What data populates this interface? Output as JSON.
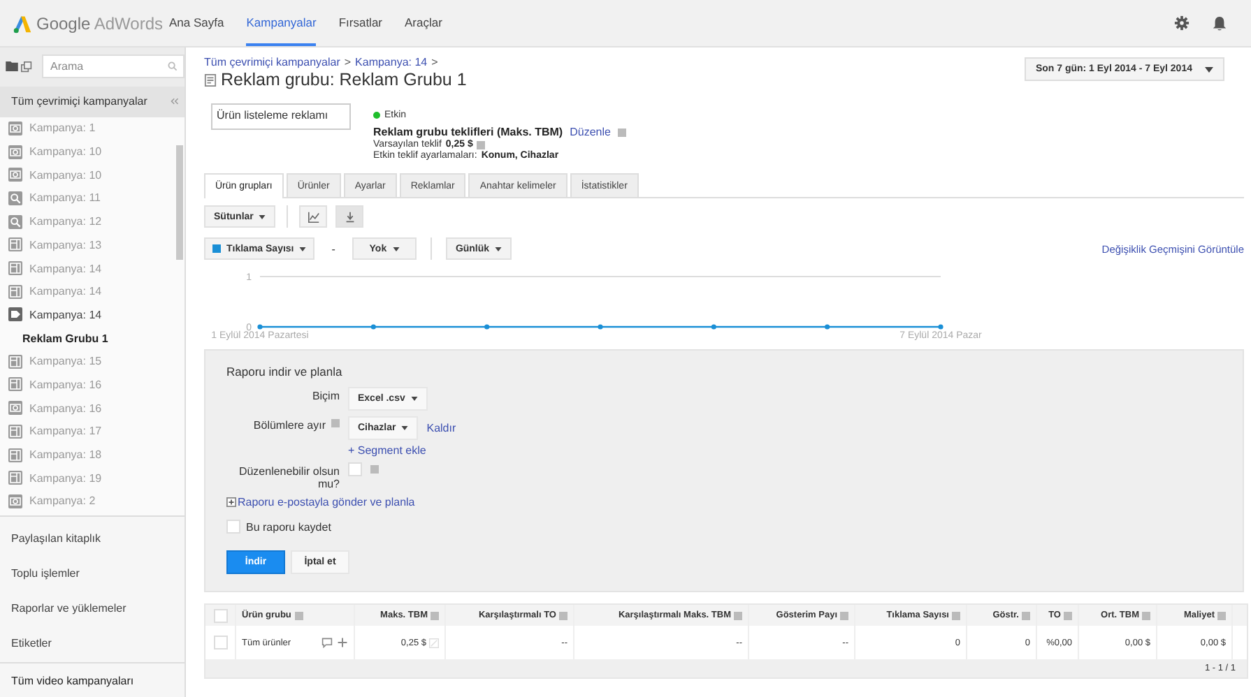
{
  "header": {
    "logo_brand": "Google",
    "logo_product": "AdWords",
    "nav": [
      {
        "label": "Ana Sayfa",
        "selected": false
      },
      {
        "label": "Kampanyalar",
        "selected": true
      },
      {
        "label": "Fırsatlar",
        "selected": false
      },
      {
        "label": "Araçlar",
        "selected": false
      }
    ]
  },
  "sidebar": {
    "search": {
      "placeholder": "Arama"
    },
    "heading": "Tüm çevrimiçi kampanyalar",
    "campaigns": [
      {
        "label": "Kampanya: 1",
        "kind": "video"
      },
      {
        "label": "Kampanya: 10",
        "kind": "video"
      },
      {
        "label": "Kampanya: 10",
        "kind": "video"
      },
      {
        "label": "Kampanya: 11",
        "kind": "search"
      },
      {
        "label": "Kampanya: 12",
        "kind": "search"
      },
      {
        "label": "Kampanya: 13",
        "kind": "display"
      },
      {
        "label": "Kampanya: 14",
        "kind": "display"
      },
      {
        "label": "Kampanya: 14",
        "kind": "display"
      },
      {
        "label": "Kampanya: 14",
        "kind": "shopping",
        "children": [
          {
            "label": "Reklam Grubu 1",
            "selected": true
          }
        ]
      },
      {
        "label": "Kampanya: 15",
        "kind": "display"
      },
      {
        "label": "Kampanya: 16",
        "kind": "display"
      },
      {
        "label": "Kampanya: 16",
        "kind": "video"
      },
      {
        "label": "Kampanya: 17",
        "kind": "display"
      },
      {
        "label": "Kampanya: 18",
        "kind": "display"
      },
      {
        "label": "Kampanya: 19",
        "kind": "display"
      },
      {
        "label": "Kampanya: 2",
        "kind": "video"
      }
    ],
    "links": [
      "Paylaşılan kitaplık",
      "Toplu işlemler",
      "Raporlar ve yüklemeler",
      "Etiketler"
    ],
    "footer_link": "Tüm video kampanyaları"
  },
  "breadcrumb": [
    {
      "label": "Tüm çevrimiçi kampanyalar",
      "separator": ">"
    },
    {
      "label": "Kampanya: 14",
      "separator": ">"
    }
  ],
  "title": "Reklam grubu: Reklam Grubu 1",
  "date_range": "Son 7 gün: 1 Eyl 2014 - 7 Eyl 2014",
  "ad_type": "Ürün listeleme reklamı",
  "status": {
    "label": "Etkin",
    "enabled": true
  },
  "bids": {
    "heading": "Reklam grubu teklifleri (Maks. TBM)",
    "edit_link": "Düzenle",
    "default_label": "Varsayılan teklif",
    "default_value": "0,25 $",
    "adjust_label": "Etkin teklif ayarlamaları:",
    "adjust_value": "Konum, Cihazlar"
  },
  "tabs": [
    {
      "label": "Ürün grupları",
      "selected": true
    },
    {
      "label": "Ürünler",
      "selected": false
    },
    {
      "label": "Ayarlar",
      "selected": false
    },
    {
      "label": "Reklamlar",
      "selected": false
    },
    {
      "label": "Anahtar kelimeler",
      "selected": false
    },
    {
      "label": "İstatistikler",
      "selected": false
    }
  ],
  "toolbar": {
    "columns_button": "Sütunlar",
    "dash": "-",
    "compare": "Yok",
    "period": "Günlük",
    "history_link": "Değişiklik Geçmişini Görüntüle"
  },
  "chart_data": {
    "type": "line",
    "categories": [
      "1 Eylül 2014 Pazartesi",
      null,
      null,
      null,
      null,
      null,
      "7 Eylül 2014 Pazar"
    ],
    "ylim": [
      0,
      1
    ],
    "yticks": [
      0,
      1
    ],
    "series": [
      {
        "name": "Tıklama Sayısı",
        "color": "#1a8fd6",
        "marker": "circle",
        "values": [
          0,
          0,
          0,
          0,
          0,
          0,
          0
        ]
      }
    ]
  },
  "report": {
    "title": "Raporu indir ve planla",
    "format_label": "Biçim",
    "format_value": "Excel .csv",
    "segment_label": "Bölümlere ayır",
    "segment_value": "Cihazlar",
    "remove_link": "Kaldır",
    "add_link": "+ Segment ekle",
    "editable": {
      "label": "Düzenlenebilir olsun mu?",
      "checked": false
    },
    "email_link": "Raporu e-postayla gönder ve planla",
    "save": {
      "label": "Bu raporu kaydet",
      "checked": false
    },
    "download_button": "İndir",
    "cancel_button": "İptal et"
  },
  "table": {
    "columns": [
      "Ürün grubu",
      "Maks. TBM",
      "Karşılaştırmalı TO",
      "Karşılaştırmalı Maks. TBM",
      "Gösterim Payı",
      "Tıklama Sayısı",
      "Göstr.",
      "TO",
      "Ort. TBM",
      "Maliyet"
    ],
    "all_selected": false,
    "rows": [
      {
        "selected": false,
        "cells": [
          "Tüm ürünler",
          "0,25 $",
          "--",
          "--",
          "--",
          "0",
          "0",
          "%0,00",
          "0,00 $",
          "0,00 $"
        ]
      }
    ],
    "pagination": "1 - 1 / 1"
  }
}
